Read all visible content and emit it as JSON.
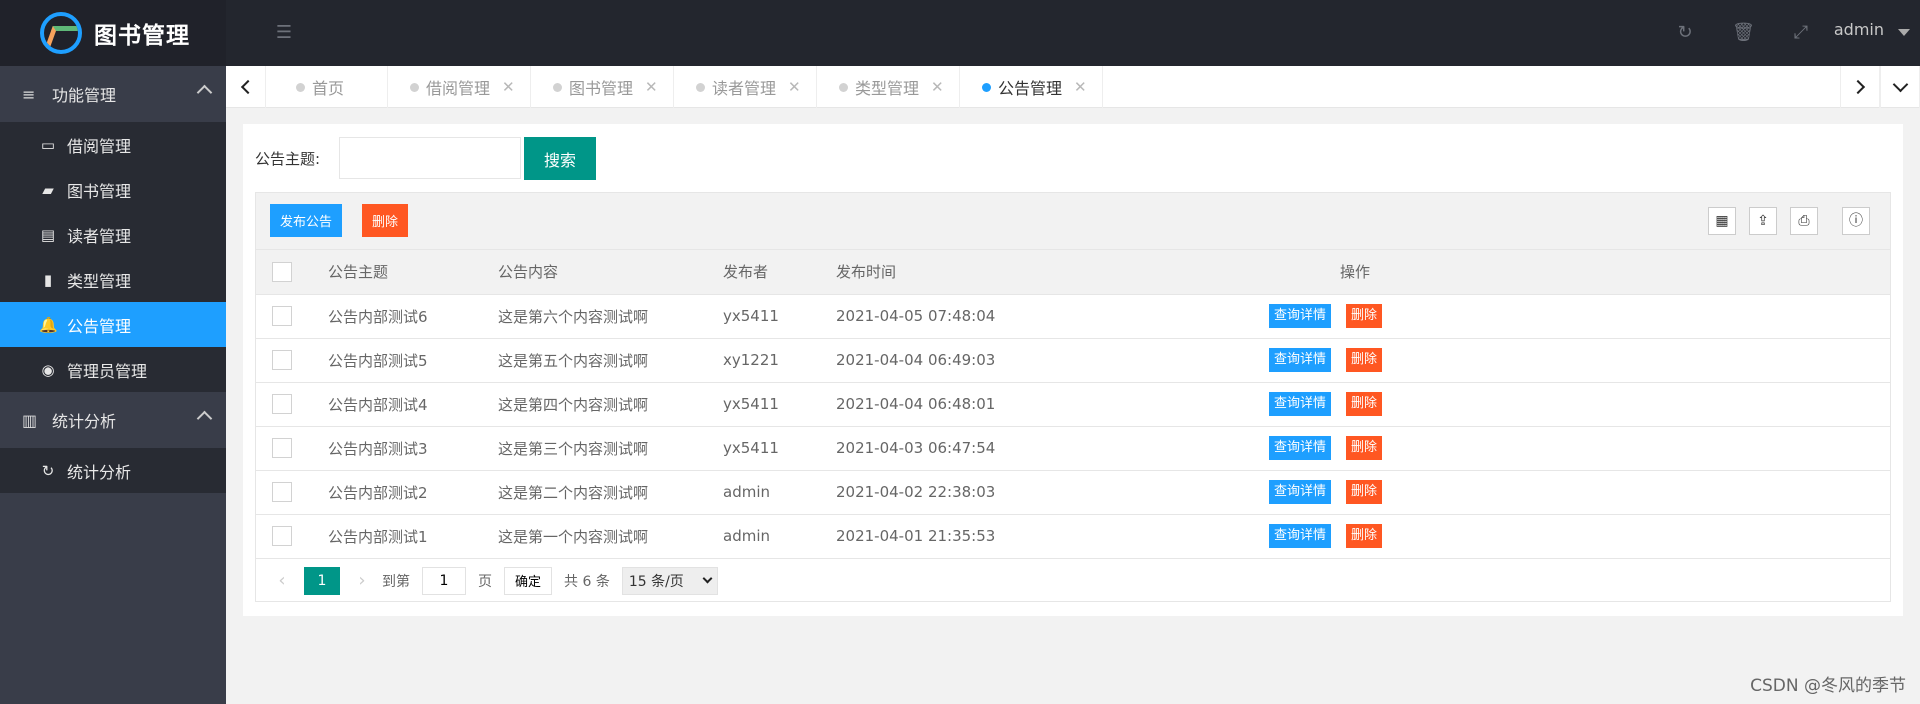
{
  "app": {
    "title": "图书管理",
    "user": "admin"
  },
  "header_icons": [
    "menu-fold-icon",
    "refresh-icon",
    "trash-icon",
    "fullscreen-icon"
  ],
  "sidebar": {
    "groups": [
      {
        "label": "功能管理",
        "icon": "list-icon",
        "items": [
          {
            "label": "借阅管理",
            "icon": "window-icon"
          },
          {
            "label": "图书管理",
            "icon": "book-icon"
          },
          {
            "label": "读者管理",
            "icon": "card-icon"
          },
          {
            "label": "类型管理",
            "icon": "file-icon"
          },
          {
            "label": "公告管理",
            "icon": "bell-icon",
            "active": true
          },
          {
            "label": "管理员管理",
            "icon": "user-icon"
          }
        ]
      },
      {
        "label": "统计分析",
        "icon": "bar-chart-icon",
        "items": [
          {
            "label": "统计分析",
            "icon": "refresh-icon"
          }
        ]
      }
    ]
  },
  "tabs": [
    {
      "label": "首页",
      "closable": false
    },
    {
      "label": "借阅管理",
      "closable": true
    },
    {
      "label": "图书管理",
      "closable": true
    },
    {
      "label": "读者管理",
      "closable": true
    },
    {
      "label": "类型管理",
      "closable": true
    },
    {
      "label": "公告管理",
      "closable": true,
      "active": true
    }
  ],
  "search": {
    "label": "公告主题:",
    "value": "",
    "button": "搜索"
  },
  "toolbar": {
    "publish": "发布公告",
    "delete": "删除"
  },
  "table": {
    "headers": [
      "公告主题",
      "公告内容",
      "发布者",
      "发布时间",
      "操作"
    ],
    "rows": [
      {
        "title": "公告内部测试6",
        "content": "这是第六个内容测试啊",
        "publisher": "yx5411",
        "time": "2021-04-05 07:48:04"
      },
      {
        "title": "公告内部测试5",
        "content": "这是第五个内容测试啊",
        "publisher": "xy1221",
        "time": "2021-04-04 06:49:03"
      },
      {
        "title": "公告内部测试4",
        "content": "这是第四个内容测试啊",
        "publisher": "yx5411",
        "time": "2021-04-04 06:48:01"
      },
      {
        "title": "公告内部测试3",
        "content": "这是第三个内容测试啊",
        "publisher": "yx5411",
        "time": "2021-04-03 06:47:54"
      },
      {
        "title": "公告内部测试2",
        "content": "这是第二个内容测试啊",
        "publisher": "admin",
        "time": "2021-04-02 22:38:03"
      },
      {
        "title": "公告内部测试1",
        "content": "这是第一个内容测试啊",
        "publisher": "admin",
        "time": "2021-04-01 21:35:53"
      }
    ],
    "row_actions": {
      "detail": "查询详情",
      "delete": "删除"
    }
  },
  "pager": {
    "current": "1",
    "goto_label": "到第",
    "goto_value": "1",
    "page_suffix": "页",
    "confirm": "确定",
    "total": "共 6 条",
    "page_size": "15 条/页"
  },
  "watermark": "CSDN @冬风的季节",
  "colors": {
    "primary": "#1e9fff",
    "success": "#009688",
    "danger": "#ff5722",
    "sidebar": "#393d49",
    "header": "#23262e"
  }
}
